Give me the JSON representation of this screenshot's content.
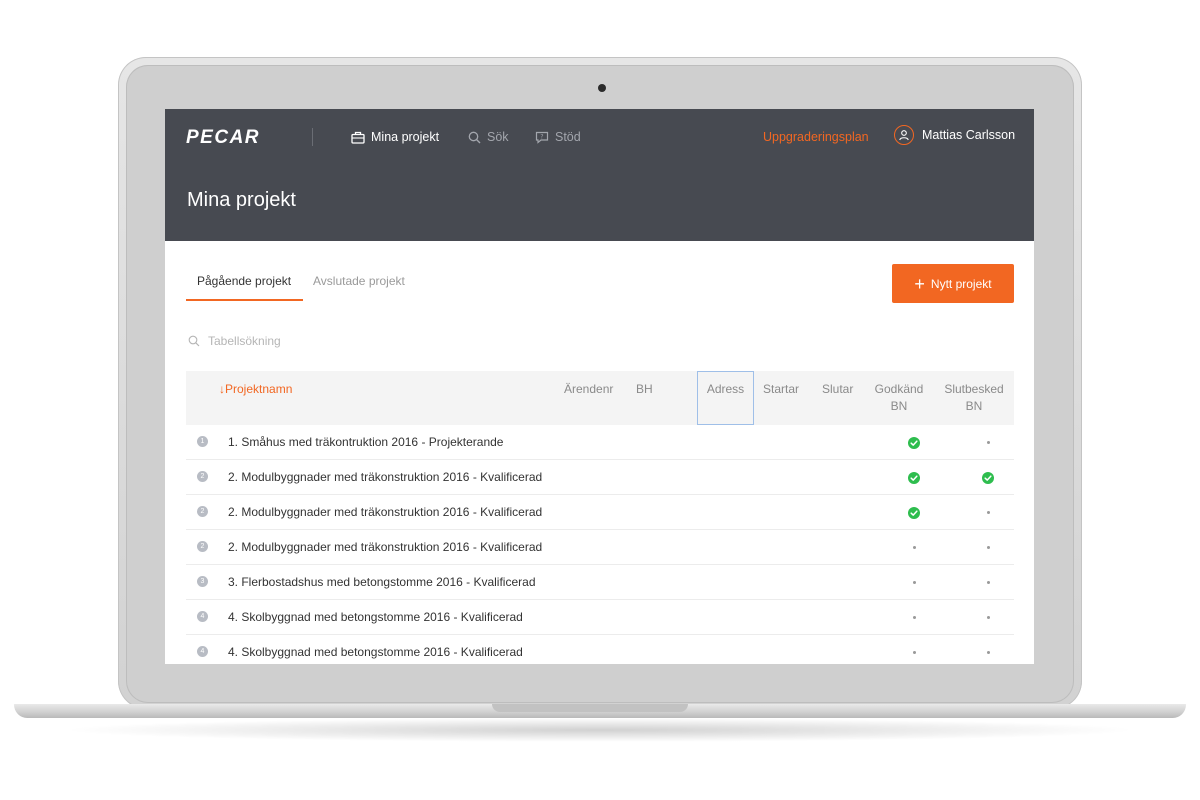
{
  "header": {
    "logo": "PECAR",
    "nav": [
      {
        "label": "Mina projekt",
        "icon": "briefcase-icon",
        "active": true
      },
      {
        "label": "Sök",
        "icon": "search-icon",
        "active": false
      },
      {
        "label": "Stöd",
        "icon": "help-chat-icon",
        "active": false
      }
    ],
    "upgrade_link": "Uppgraderingsplan",
    "user_name": "Mattias Carlsson",
    "page_title": "Mina projekt"
  },
  "tabs": [
    {
      "label": "Pågående projekt",
      "active": true
    },
    {
      "label": "Avslutade projekt",
      "active": false
    }
  ],
  "new_project_button": {
    "label": "Nytt projekt"
  },
  "search": {
    "placeholder": "Tabellsökning",
    "value": ""
  },
  "table": {
    "columns": [
      {
        "label": "↓Projektnamn",
        "sorted": true
      },
      {
        "label": "Ärendenr"
      },
      {
        "label": "BH"
      },
      {
        "label": "Adress",
        "focused": true
      },
      {
        "label": "Startar"
      },
      {
        "label": "Slutar"
      },
      {
        "label": "Godkänd BN"
      },
      {
        "label": "Slutbesked BN"
      }
    ],
    "rows": [
      {
        "num": "1",
        "name": "1. Småhus med träkontruktion 2016 - Projekterande",
        "godkand": true,
        "slutbesked": false
      },
      {
        "num": "2",
        "name": "2. Modulbyggnader med träkonstruktion 2016 - Kvalificerad",
        "godkand": true,
        "slutbesked": true
      },
      {
        "num": "2",
        "name": "2. Modulbyggnader med träkonstruktion 2016 - Kvalificerad",
        "godkand": true,
        "slutbesked": false
      },
      {
        "num": "2",
        "name": "2. Modulbyggnader med träkonstruktion 2016 - Kvalificerad",
        "godkand": false,
        "slutbesked": false
      },
      {
        "num": "3",
        "name": "3. Flerbostadshus med betongstomme 2016 - Kvalificerad",
        "godkand": false,
        "slutbesked": false
      },
      {
        "num": "4",
        "name": "4. Skolbyggnad med betongstomme 2016 - Kvalificerad",
        "godkand": false,
        "slutbesked": false
      },
      {
        "num": "4",
        "name": "4. Skolbyggnad med betongstomme 2016 - Kvalificerad",
        "godkand": false,
        "slutbesked": false
      }
    ]
  },
  "colors": {
    "accent": "#f26722",
    "header_bg": "#474a51",
    "check_green": "#2ebd4e"
  }
}
